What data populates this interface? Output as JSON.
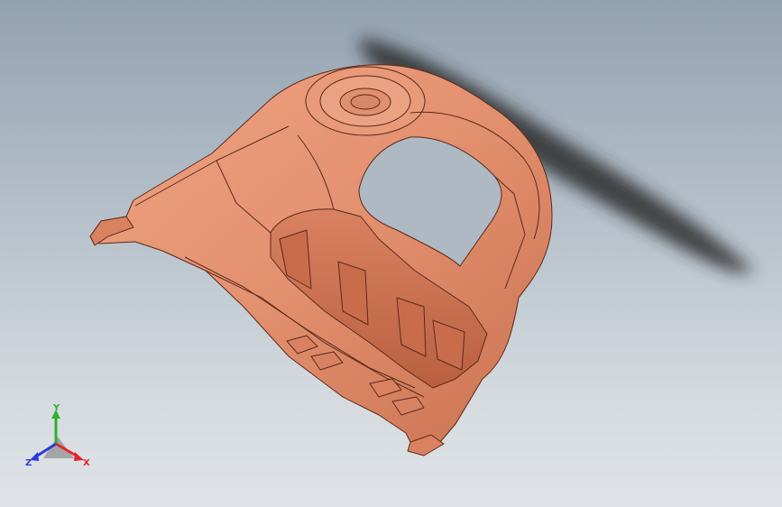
{
  "viewport": {
    "background_top": "#93a2b1",
    "background_bottom": "#dfe3e7"
  },
  "model": {
    "part_color": "#e3906f",
    "edge_color": "#5a2a1a",
    "shadow_color": "#2b2b2b"
  },
  "triad": {
    "y_label": "Y",
    "x_label": "X",
    "z_label": "Z",
    "x_color": "#e0282a",
    "y_color": "#2fb02f",
    "z_color": "#2a3bd6"
  }
}
